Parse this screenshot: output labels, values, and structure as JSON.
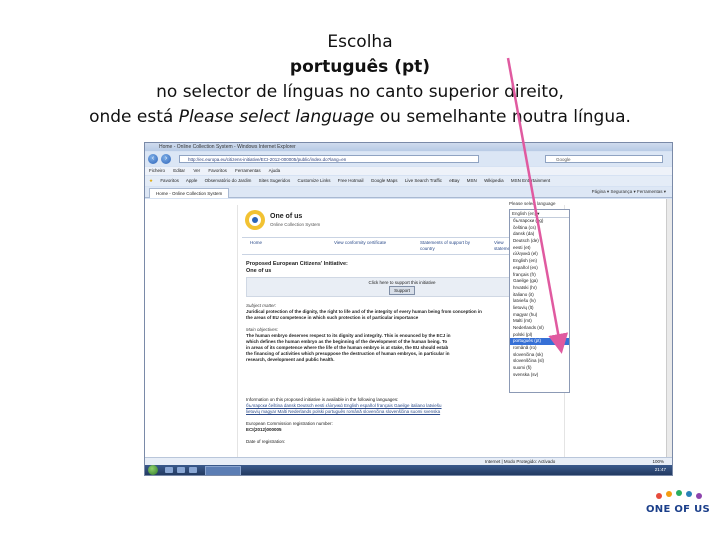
{
  "caption": {
    "line1": "Escolha",
    "line2": "português (pt)",
    "line3": "no selector de línguas no canto superior direito,",
    "line4_before": "onde está ",
    "line4_italic": "Please select language",
    "line4_after": " ou semelhante noutra língua."
  },
  "browser": {
    "title": "Home - Online Collection System - Windows Internet Explorer",
    "address": "http://ec.europa.eu/citizens-initiative/ECI-2012-000005/public/index.do?lang=en",
    "search_placeholder": "Google",
    "menu": [
      "Ficheiro",
      "Editar",
      "Ver",
      "Favoritos",
      "Ferramentas",
      "Ajuda"
    ],
    "favorites": [
      "Favoritos",
      "Apple",
      "Observatório do Jardim",
      "Sites Sugeridos",
      "Customize Links",
      "Free Hotmail",
      "Google Maps",
      "Live Search Traffic",
      "eBay",
      "MSN",
      "Wikipedia",
      "MSN Entertainment"
    ],
    "tab_label": "Home - Online Collection System",
    "tab_tools": "Página ▾  Segurança ▾  Ferramentas ▾",
    "status_left": "Internet | Modo Protegido: Activado",
    "zoom": "100%",
    "clock": "21:47"
  },
  "page": {
    "logo_title": "One of us",
    "logo_subtitle": "Online Collection System",
    "nav": [
      "Home",
      "View conformity certificate",
      "Statements of support by country",
      "View statements"
    ],
    "initiative_heading_1": "Proposed European Citizens' Initiative:",
    "initiative_heading_2": "One of us",
    "support_prompt": "Click here to support this initiative",
    "support_button": "Support",
    "subject_label": "Subject matter:",
    "subject_text_1": "Juridical protection of the dignity, the right to life and of the integrity of every human being from conception in",
    "subject_text_2": "the areas of EU competence in which such protection is of particular importance",
    "objectives_label": "Main objectives:",
    "objectives_lines": [
      "The human embryo deserves respect to its dignity and integrity. This is enounced by the ECJ in",
      "which defines the human embryo as the beginning of the development of the human being. To",
      "in areas of its competence where the life of the human embryo is at stake, the EU should estab",
      "the financing of activities which presuppose the destruction of human embryos, in particular in",
      "research, development and public health."
    ],
    "languages_info": "Information on this proposed initiative is available in the following languages:",
    "languages_line1": "български  čeština  dansk  Deutsch  eesti  ελληνικά  English  español  français  Gaeilge  italiano  latviešu",
    "languages_line2": "lietuvių  magyar  Malti  Nederlands  polski  português  română  slovenčina  slovenščina  suomi  svenska",
    "registration_label": "European Commission registration number:",
    "registration_number": "ECI(2012)000005",
    "date_label": "Date of registration:"
  },
  "language_select": {
    "label": "Please select language",
    "current": "English (en)",
    "options": [
      "български (bg)",
      "čeština (cs)",
      "dansk (da)",
      "Deutsch (de)",
      "eesti (et)",
      "ελληνικά (el)",
      "English (en)",
      "español (es)",
      "français (fr)",
      "Gaeilge (ga)",
      "hrvatski (hr)",
      "italiano (it)",
      "latviešu (lv)",
      "lietuvių (lt)",
      "magyar (hu)",
      "Malti (mt)",
      "Nederlands (nl)",
      "polski (pl)",
      "português (pt)",
      "română (ro)",
      "slovenčina (sk)",
      "slovenščina (sl)",
      "suomi (fi)",
      "svenska (sv)"
    ],
    "selected_index": 18
  },
  "colors": {
    "arrow": "#e05aa0",
    "selection": "#3670d6",
    "footer_logo_text": "#1b3f8a"
  },
  "footer_logo_text": "ONE OF US"
}
